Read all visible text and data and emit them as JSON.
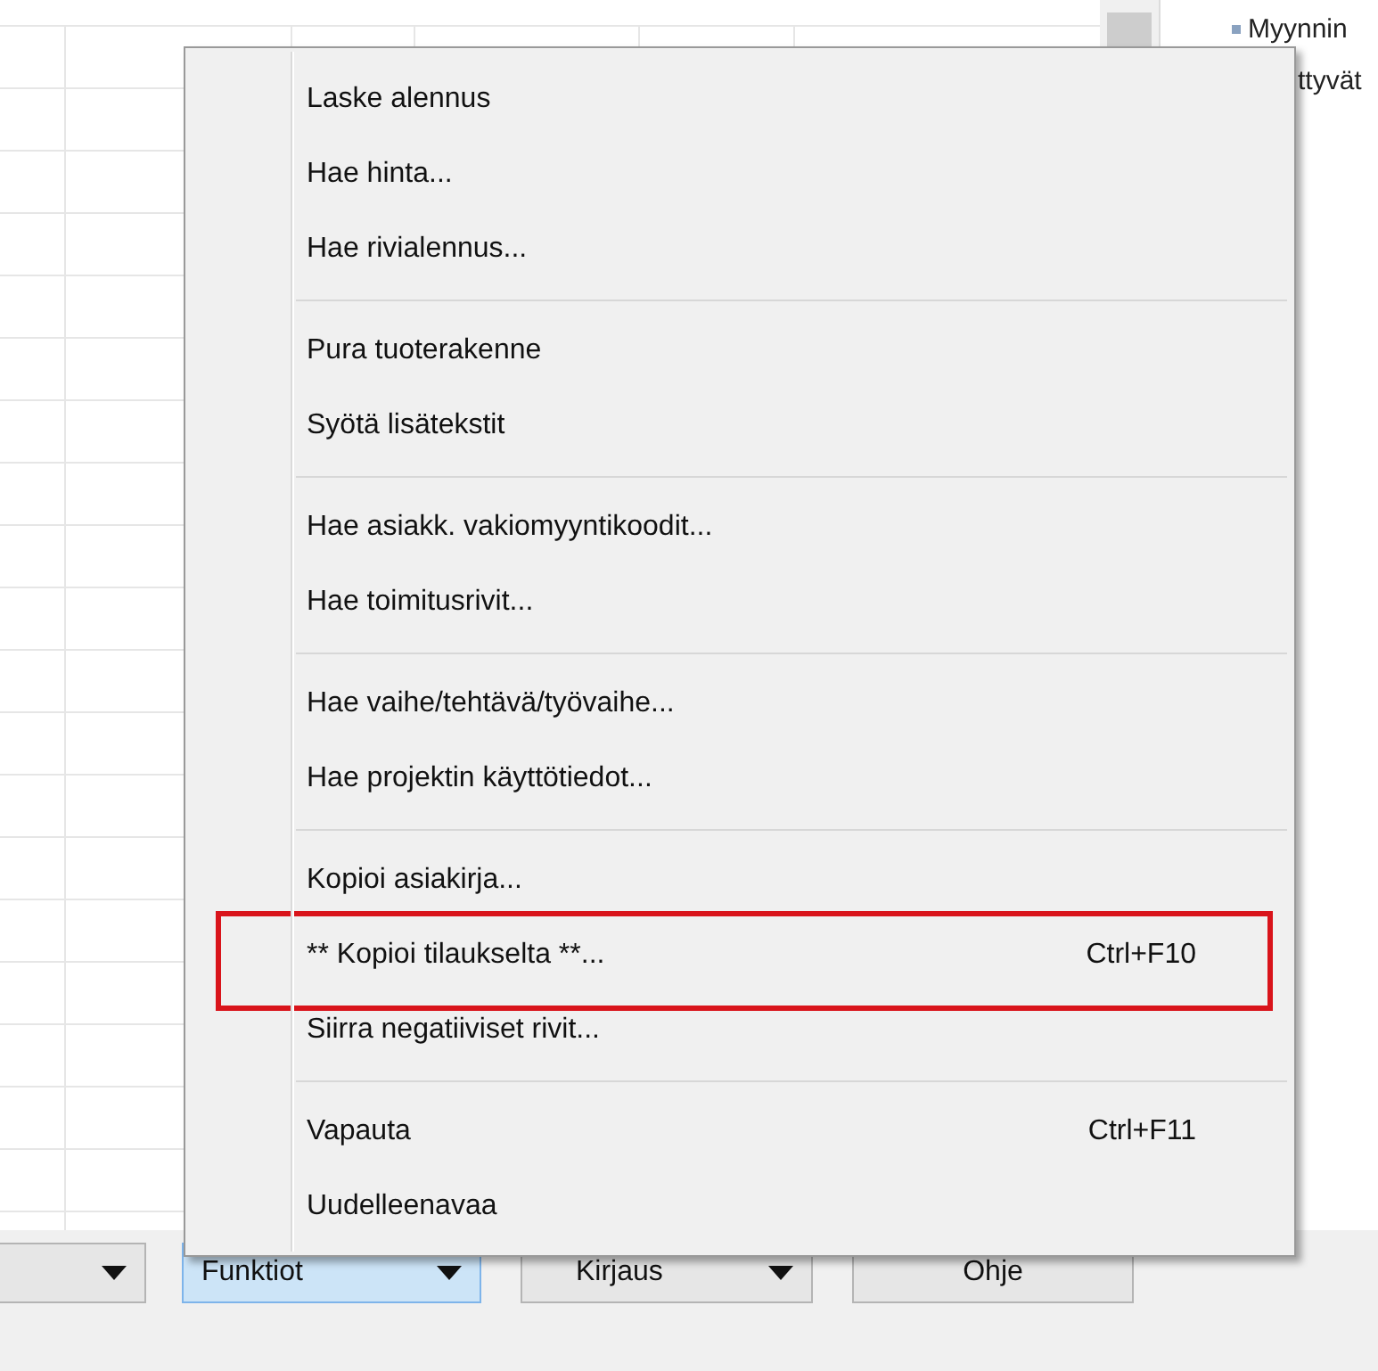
{
  "side_panel": {
    "link": "Myynnin",
    "text": "ttyvät"
  },
  "menu": {
    "groups": [
      [
        {
          "label": "Laske alennus",
          "annotated": false
        },
        {
          "label": "Hae hinta...",
          "annotated": false
        },
        {
          "label": "Hae rivialennus...",
          "annotated": false
        }
      ],
      [
        {
          "label": "Pura tuoterakenne",
          "annotated": false
        },
        {
          "label": "Syötä lisätekstit",
          "annotated": false
        }
      ],
      [
        {
          "label": "Hae asiakk. vakiomyyntikoodit...",
          "annotated": false
        },
        {
          "label": "Hae toimitusrivit...",
          "annotated": false
        }
      ],
      [
        {
          "label": "Hae vaihe/tehtävä/työvaihe...",
          "annotated": false
        },
        {
          "label": "Hae projektin käyttötiedot...",
          "annotated": false
        }
      ],
      [
        {
          "label": "Kopioi asiakirja...",
          "annotated": false
        },
        {
          "label": "** Kopioi tilaukselta **...",
          "shortcut": "Ctrl+F10",
          "annotated": true
        },
        {
          "label": "Siirra negatiiviset rivit...",
          "annotated": false
        }
      ],
      [
        {
          "label": "Vapauta",
          "shortcut": "Ctrl+F11",
          "annotated": false
        },
        {
          "label": "Uudelleenavaa",
          "annotated": false
        }
      ]
    ]
  },
  "buttons": [
    {
      "dropdown": true,
      "active": false
    },
    {
      "label": "Funktiot",
      "dropdown": true,
      "active": true
    },
    {
      "label": "Kirjaus",
      "dropdown": true,
      "active": false
    },
    {
      "label": "Ohje",
      "dropdown": false,
      "active": false
    }
  ]
}
